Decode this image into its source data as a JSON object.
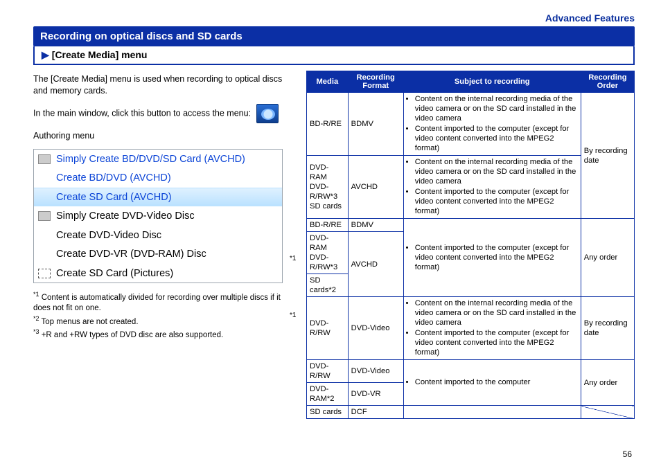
{
  "header": "Advanced Features",
  "title": "Recording on optical discs and SD cards",
  "subtitle": "[Create Media] menu",
  "intro1": "The [Create Media] menu is used when recording to optical discs and memory cards.",
  "intro2": "In the main window, click this button to access the menu:",
  "authoring_label": "Authoring menu",
  "menu": {
    "items": [
      "Simply Create BD/DVD/SD Card (AVCHD)",
      "Create BD/DVD (AVCHD)",
      "Create SD Card (AVCHD)",
      "Simply Create DVD-Video Disc",
      "Create DVD-Video Disc",
      "Create DVD-VR (DVD-RAM) Disc",
      "Create SD Card (Pictures)"
    ]
  },
  "annotations": {
    "star1": "*1",
    "star2": "*2",
    "star3": "*3"
  },
  "footnotes": [
    "Content is automatically divided for recording over multiple discs if it does not fit on one.",
    "Top menus are not created.",
    "+R and +RW types of DVD disc are also supported."
  ],
  "table": {
    "headers": [
      "Media",
      "Recording Format",
      "Subject to recording",
      "Recording Order"
    ],
    "rows": [
      {
        "media": "BD-R/RE",
        "format": "BDMV",
        "subject": [
          "Content on the internal recording media of the video camera or on the SD card installed in the video camera",
          "Content imported to the computer (except for video content converted into the MPEG2 format)"
        ]
      },
      {
        "media": "DVD-RAM\nDVD-R/RW*3\nSD cards",
        "format": "AVCHD",
        "subject": [
          "Content on the internal recording media of the video camera or on the SD card installed in the video camera",
          "Content imported to the computer (except for video content converted into the MPEG2 format)"
        ]
      },
      {
        "media": "BD-R/RE",
        "format": "BDMV"
      },
      {
        "media": "DVD-RAM\nDVD-R/RW*3",
        "format": "AVCHD"
      },
      {
        "media": "SD cards*2"
      },
      {
        "media": "DVD-R/RW",
        "format": "DVD-Video",
        "subject": [
          "Content on the internal recording media of the video camera or on the SD card installed in the video camera",
          "Content imported to the computer (except for video content converted into the MPEG2 format)"
        ]
      },
      {
        "media": "DVD-R/RW",
        "format": "DVD-Video"
      },
      {
        "media": "DVD-RAM*2",
        "format": "DVD-VR"
      },
      {
        "media": "SD cards",
        "format": "DCF"
      }
    ],
    "order": [
      "By recording date",
      "Any order",
      "By recording date",
      "Any order"
    ],
    "subject_group2": [
      "Content imported to the computer (except for video content converted into the MPEG2 format)"
    ],
    "subject_group4": [
      "Content imported to the computer"
    ]
  },
  "page_number": "56"
}
